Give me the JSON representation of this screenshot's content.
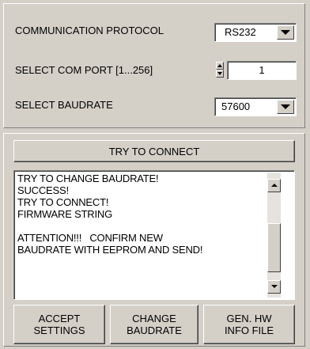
{
  "settings": {
    "protocol_label": "COMMUNICATION PROTOCOL",
    "protocol_value": "RS232",
    "com_port_label": "SELECT COM PORT [1...256]",
    "com_port_value": "1",
    "baudrate_label": "SELECT BAUDRATE",
    "baudrate_value": "57600"
  },
  "connect": {
    "button_label": "TRY TO CONNECT"
  },
  "log": {
    "lines": [
      "TRY TO CHANGE BAUDRATE!",
      "SUCCESS!",
      "TRY TO CONNECT!",
      "FIRMWARE STRING",
      "",
      "ATTENTION!!!   CONFIRM NEW",
      "BAUDRATE WITH EEPROM AND SEND!"
    ]
  },
  "actions": {
    "accept_line1": "ACCEPT",
    "accept_line2": "SETTINGS",
    "change_line1": "CHANGE",
    "change_line2": "BAUDRATE",
    "genhw_line1": "GEN. HW",
    "genhw_line2": "INFO FILE"
  },
  "colors": {
    "window_bg": "#d4d0c8",
    "field_bg": "#ffffff"
  }
}
